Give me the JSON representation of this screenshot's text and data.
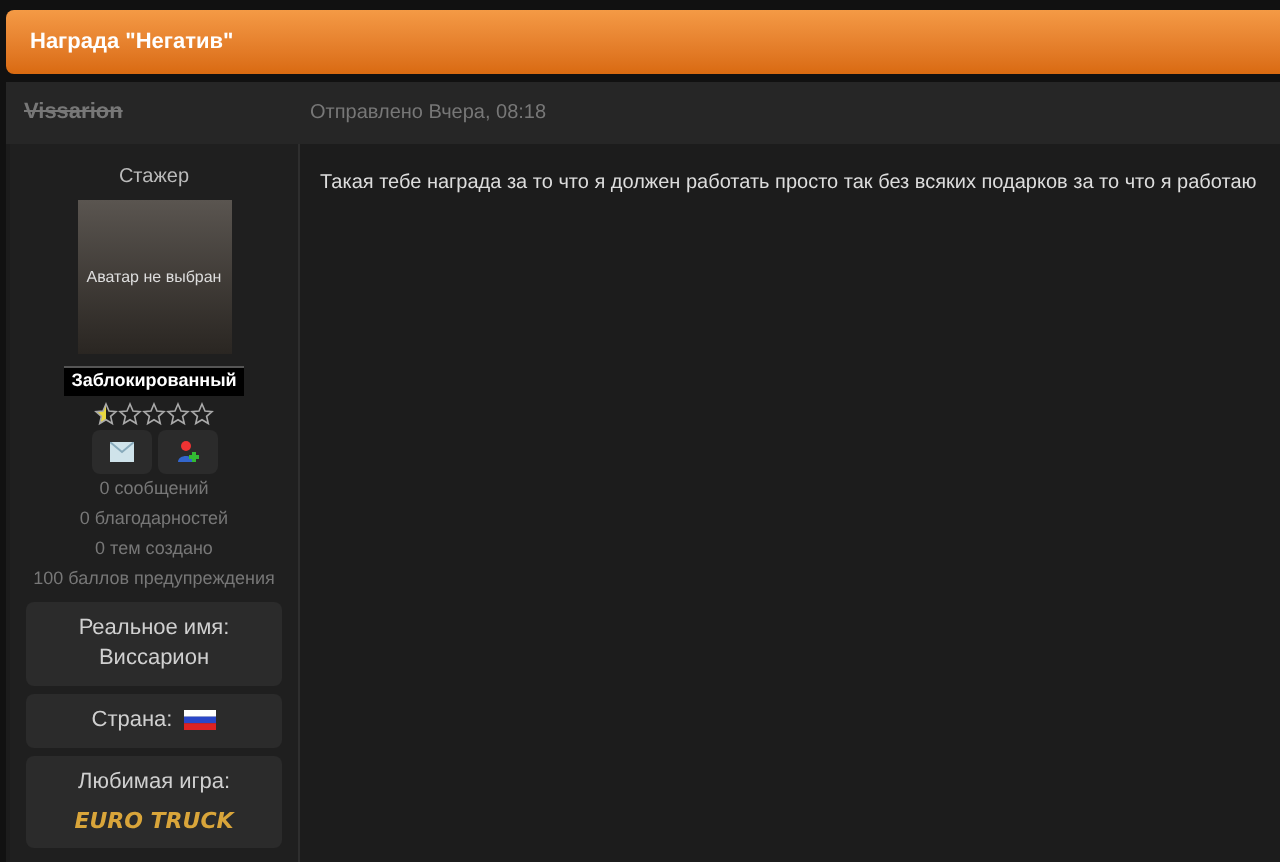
{
  "title": "Награда \"Негатив\"",
  "author": {
    "name": "Vissarion",
    "banned": true
  },
  "post_meta": "Отправлено Вчера, 08:18",
  "profile": {
    "rank": "Стажер",
    "avatar_text": "Аватар не выбран",
    "group": "Заблокированный",
    "stars": 0.5,
    "stats": [
      "0 сообщений",
      "0 благодарностей",
      "0 тем создано",
      "100 баллов предупреждения"
    ],
    "fields": [
      {
        "kind": "text",
        "label": "Реальное имя: Виссарион"
      },
      {
        "kind": "flag",
        "label": "Страна:"
      },
      {
        "kind": "game",
        "label": "Любимая игра:",
        "logo_text": "EURO TRUCK"
      }
    ]
  },
  "message": "Такая тебе награда за то что я должен работать просто так без всяких подарков за то что я работаю"
}
